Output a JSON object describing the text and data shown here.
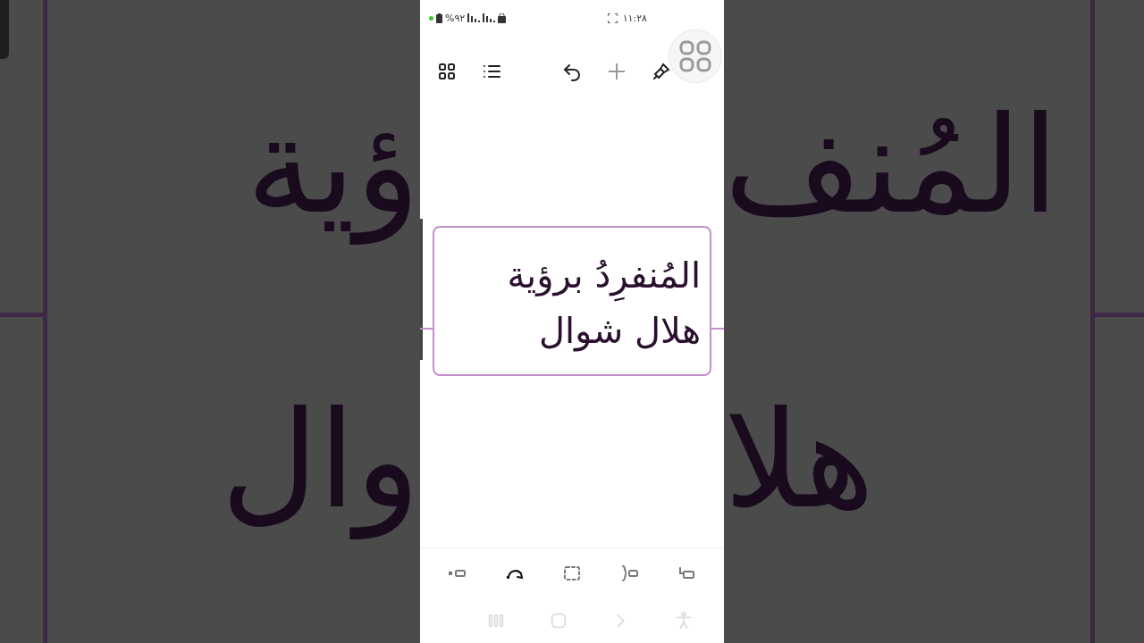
{
  "backdrop": {
    "left_lines": [
      "ؤية",
      "وال"
    ],
    "right_lines": [
      "المُنف",
      "هلا"
    ]
  },
  "status_bar": {
    "battery": "%٩٢",
    "time": "١١:٢٨"
  },
  "mind_map": {
    "node": {
      "lines": [
        "المُنفرِدُ برؤية",
        "هلال شوال"
      ]
    }
  }
}
